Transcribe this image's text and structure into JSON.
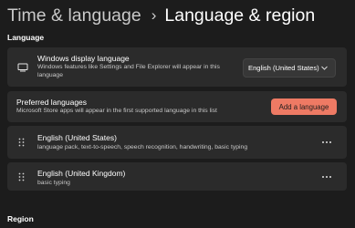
{
  "breadcrumb": {
    "parent": "Time & language",
    "separator": "›",
    "current": "Language & region"
  },
  "language_section": {
    "header": "Language",
    "display_language": {
      "title": "Windows display language",
      "description": "Windows features like Settings and File Explorer will appear in this language",
      "selected": "English (United States)",
      "icon": "monitor-icon"
    },
    "preferred": {
      "title": "Preferred languages",
      "description": "Microsoft Store apps will appear in the first supported language in this list",
      "add_button": "Add a language"
    },
    "languages": [
      {
        "name": "English (United States)",
        "features": "language pack, text-to-speech, speech recognition, handwriting, basic typing"
      },
      {
        "name": "English (United Kingdom)",
        "features": "basic typing"
      }
    ]
  },
  "region_section": {
    "header": "Region"
  },
  "colors": {
    "background": "#1c1c1c",
    "card": "#2b2b2b",
    "accent": "#ee7a64"
  }
}
